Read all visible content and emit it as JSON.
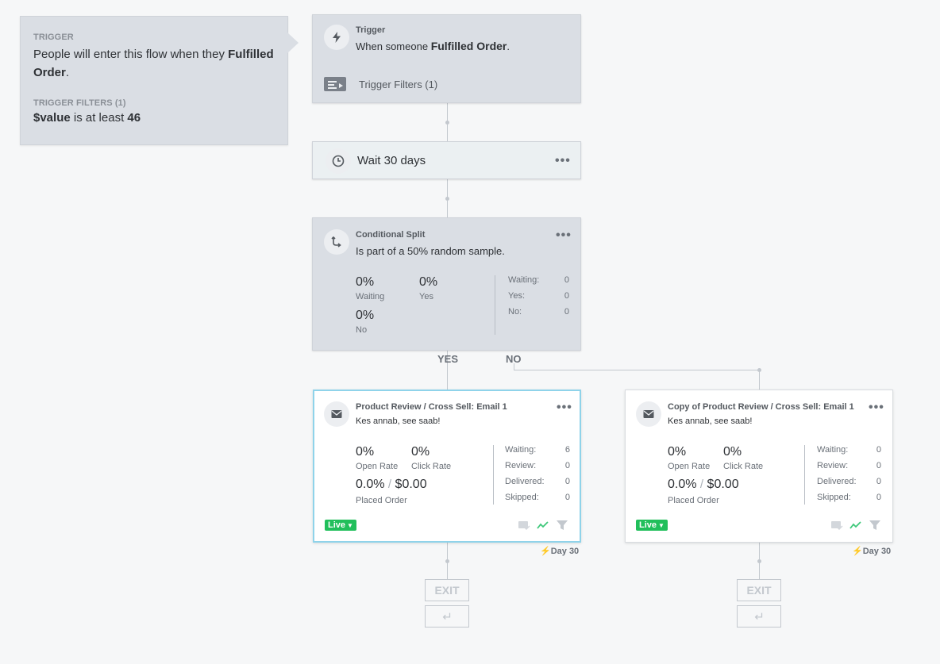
{
  "side_panel": {
    "trigger_heading": "TRIGGER",
    "trigger_text_prefix": "People will enter this flow when they",
    "trigger_metric": "Fulfilled Order",
    "trigger_text_suffix": ".",
    "filters_heading": "TRIGGER FILTERS (1)",
    "filter_property": "$value",
    "filter_operator": "is at least",
    "filter_value": "46"
  },
  "trigger_card": {
    "title": "Trigger",
    "text_prefix": "When someone",
    "metric": "Fulfilled Order",
    "text_suffix": ".",
    "filters_label": "Trigger Filters (1)"
  },
  "wait_card": {
    "label": "Wait 30 days",
    "menu": "•••"
  },
  "split_card": {
    "title": "Conditional Split",
    "description": "Is part of a 50% random sample.",
    "menu": "•••",
    "stats": [
      {
        "value": "0%",
        "label": "Waiting"
      },
      {
        "value": "0%",
        "label": "Yes"
      },
      {
        "value": "0%",
        "label": "No"
      }
    ],
    "counts": [
      {
        "key": "Waiting:",
        "value": "0"
      },
      {
        "key": "Yes:",
        "value": "0"
      },
      {
        "key": "No:",
        "value": "0"
      }
    ]
  },
  "branches": {
    "yes": "YES",
    "no": "NO"
  },
  "emails": [
    {
      "title": "Product Review / Cross Sell: Email 1",
      "subject": "Kes annab, see saab!",
      "menu": "•••",
      "open_rate": "0%",
      "open_rate_label": "Open Rate",
      "click_rate": "0%",
      "click_rate_label": "Click Rate",
      "placed_pct": "0.0%",
      "placed_value": "$0.00",
      "placed_label": "Placed Order",
      "counts": [
        {
          "key": "Waiting:",
          "value": "6"
        },
        {
          "key": "Review:",
          "value": "0"
        },
        {
          "key": "Delivered:",
          "value": "0"
        },
        {
          "key": "Skipped:",
          "value": "0"
        }
      ],
      "status": "Live",
      "day": "Day 30",
      "exit": "EXIT"
    },
    {
      "title": "Copy of Product Review / Cross Sell: Email 1",
      "subject": "Kes annab, see saab!",
      "menu": "•••",
      "open_rate": "0%",
      "open_rate_label": "Open Rate",
      "click_rate": "0%",
      "click_rate_label": "Click Rate",
      "placed_pct": "0.0%",
      "placed_value": "$0.00",
      "placed_label": "Placed Order",
      "counts": [
        {
          "key": "Waiting:",
          "value": "0"
        },
        {
          "key": "Review:",
          "value": "0"
        },
        {
          "key": "Delivered:",
          "value": "0"
        },
        {
          "key": "Skipped:",
          "value": "0"
        }
      ],
      "status": "Live",
      "day": "Day 30",
      "exit": "EXIT"
    }
  ],
  "colors": {
    "live": "#21bf5b",
    "selected_border": "#8fd3ea",
    "card_bg": "#dadee4"
  },
  "icons": [
    "bolt-icon",
    "filter-list-icon",
    "clock-icon",
    "split-icon",
    "envelope-icon",
    "mail-check-icon",
    "trend-icon",
    "funnel-icon",
    "return-arrow-icon"
  ]
}
